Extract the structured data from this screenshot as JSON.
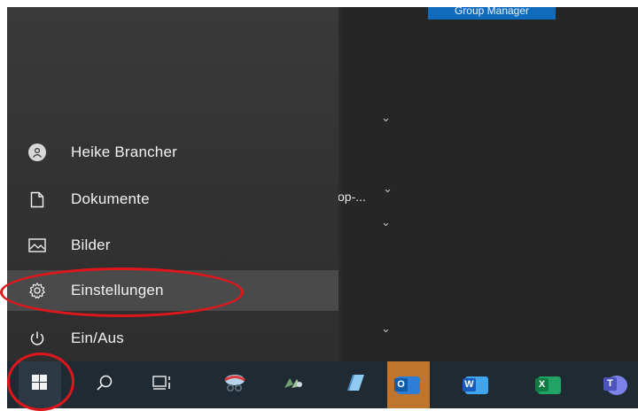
{
  "desktop": {
    "group_badge": "Group Manager",
    "truncated_label": "op-..."
  },
  "start_menu": {
    "items": [
      {
        "label": "Heike Brancher",
        "icon": "user-avatar-icon"
      },
      {
        "label": "Dokumente",
        "icon": "document-icon"
      },
      {
        "label": "Bilder",
        "icon": "pictures-icon"
      },
      {
        "label": "Einstellungen",
        "icon": "gear-icon"
      },
      {
        "label": "Ein/Aus",
        "icon": "power-icon"
      }
    ]
  },
  "taskbar": {
    "items": [
      "start-icon",
      "search-icon",
      "task-view-icon",
      "snipping-tool-icon",
      "app-icon",
      "notepad-icon",
      "outlook-icon",
      "word-icon",
      "excel-icon",
      "teams-icon"
    ],
    "app_letters": {
      "outlook": "O",
      "word": "W",
      "excel": "X",
      "teams": "T"
    }
  },
  "colors": {
    "annotation_red": "#e0161b",
    "accent_blue": "#0f6cbd",
    "outlook_highlight": "#c0752f"
  }
}
